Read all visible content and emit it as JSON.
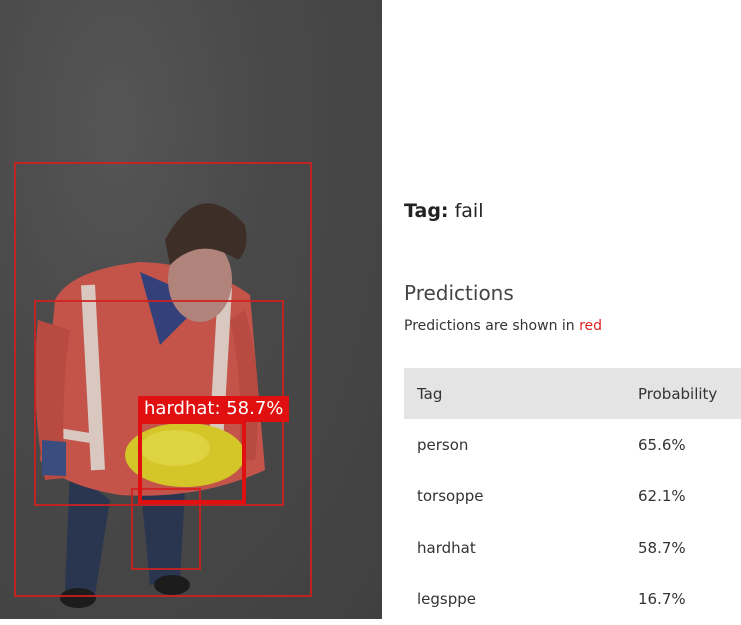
{
  "image": {
    "detection_label": "hardhat: 58.7%"
  },
  "tag": {
    "key": "Tag:",
    "value": "fail"
  },
  "predictions": {
    "heading": "Predictions",
    "subtitle_prefix": "Predictions are shown in",
    "subtitle_color_word": "red",
    "columns": [
      "Tag",
      "Probability"
    ],
    "rows": [
      {
        "tag": "person",
        "probability": "65.6%"
      },
      {
        "tag": "torsoppe",
        "probability": "62.1%"
      },
      {
        "tag": "hardhat",
        "probability": "58.7%"
      },
      {
        "tag": "legsppe",
        "probability": "16.7%"
      }
    ]
  },
  "colors": {
    "accent_red": "#e01010",
    "header_bg": "#e4e4e4"
  }
}
